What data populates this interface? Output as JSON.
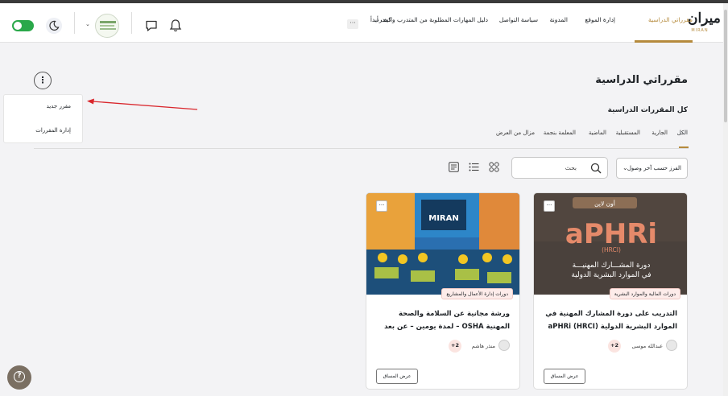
{
  "brand": {
    "logo_text": "ميران",
    "logo_word": "MIRAN",
    "accent_color": "#b58a3c"
  },
  "nav": {
    "items": [
      {
        "label": "مقرراتي الدراسية",
        "active": true
      },
      {
        "label": "إدارة الموقع"
      },
      {
        "label": "المدونة"
      },
      {
        "label": "سياسة التواصل"
      },
      {
        "label": "دليل المهارات المطلوبة من المتدرب والمدرب"
      },
      {
        "label": "كيف أبدأ"
      }
    ],
    "more_label": "···",
    "toggle_on": true
  },
  "page": {
    "title": "مقرراتي الدراسية"
  },
  "menu": {
    "button_label": "⋮",
    "items": [
      {
        "label": "مقرر جديد"
      },
      {
        "label": "إدارة المقررات"
      }
    ]
  },
  "courses_section": {
    "title": "كل المقررات الدراسية",
    "tabs": [
      {
        "label": "الكل",
        "active": true
      },
      {
        "label": "الجارية"
      },
      {
        "label": "المستقبلية"
      },
      {
        "label": "الماضية"
      },
      {
        "label": "المعلمة بنجمة"
      },
      {
        "label": "مزال من العرض"
      }
    ],
    "sort_label": "الفرز حسب آخر وصول",
    "search_placeholder": "بحث"
  },
  "cards": [
    {
      "image_banner": "أون لاين",
      "image_title": "aPHRi",
      "image_sub": "(HRCI)",
      "image_line1": "دورة المشـــارك المهنيـــة",
      "image_line2": "في الموارد البشرية الدولية",
      "category": "دورات المالية والموارد البشرية",
      "title": "التدريب على دورة المشارك المهنية في الموارد البشرية الدولية aPHRi (HRCI)",
      "teacher": "عبدالله موسى",
      "more": "+2",
      "button": "عرض المساق",
      "dots": "···"
    },
    {
      "image_banner": "MIRAN",
      "category": "دورات إدارة الأعمال والمشاريع",
      "title": "ورشة مجانية عن السلامة والصحة المهنية OSHA – لمدة يومين – عن بعد",
      "teacher": "منذر هاشم",
      "more": "+2",
      "button": "عرض المساق",
      "dots": "···"
    }
  ],
  "help_label": "?"
}
